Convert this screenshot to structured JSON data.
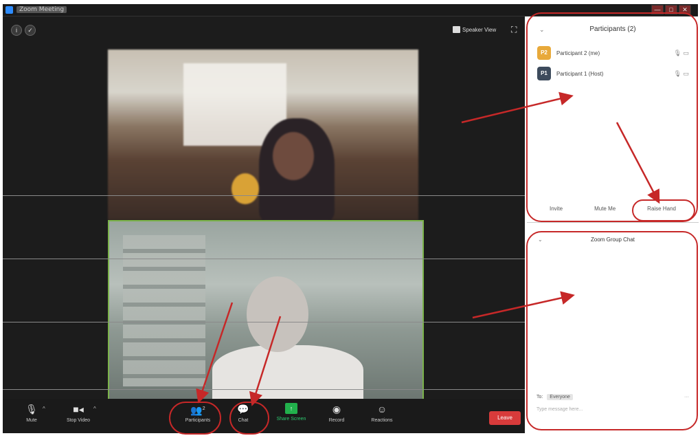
{
  "window": {
    "title": "Zoom Meeting",
    "controls": [
      "—",
      "□",
      "✕"
    ]
  },
  "top_bar": {
    "speaker_view_label": "Speaker View",
    "fullscreen_glyph": "⛶"
  },
  "toolbar": {
    "mute_label": "Mute",
    "stop_video_label": "Stop Video",
    "participants_label": "Participants",
    "participants_count": "2",
    "chat_label": "Chat",
    "share_screen_label": "Share Screen",
    "record_label": "Record",
    "reactions_label": "Reactions",
    "leave_label": "Leave"
  },
  "participants_panel": {
    "title": "Participants (2)",
    "participants": [
      {
        "initials": "P2",
        "name": "Participant 2 (me)",
        "color": "#e8a93a"
      },
      {
        "initials": "P1",
        "name": "Participant 1 (Host)",
        "color": "#3d4b5c"
      }
    ],
    "actions": {
      "invite": "Invite",
      "mute_me": "Mute Me",
      "raise_hand": "Raise Hand"
    }
  },
  "chat_panel": {
    "title": "Zoom Group Chat",
    "to_label": "To:",
    "to_value": "Everyone",
    "input_placeholder": "Type message here..."
  },
  "annotation_color": "#c62828"
}
